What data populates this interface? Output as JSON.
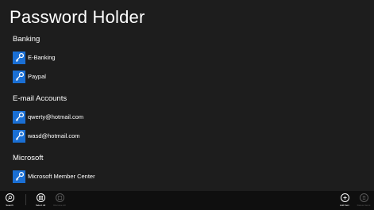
{
  "app": {
    "title": "Password Holder"
  },
  "colors": {
    "background": "#1d1d1d",
    "tile": "#1a6fd4",
    "appbar": "#0f0f0f"
  },
  "groups": [
    {
      "header": "Banking",
      "items": [
        {
          "label": "E-Banking",
          "icon": "key-icon"
        },
        {
          "label": "Paypal",
          "icon": "key-icon"
        }
      ]
    },
    {
      "header": "E-mail Accounts",
      "items": [
        {
          "label": "qwerty@hotmail.com",
          "icon": "key-icon"
        },
        {
          "label": "wasd@hotmail.com",
          "icon": "key-icon"
        }
      ]
    },
    {
      "header": "Microsoft",
      "items": [
        {
          "label": "Microsoft Member Center",
          "icon": "key-icon"
        }
      ]
    }
  ],
  "appbar": {
    "search_label": "Search",
    "select_all_label": "Select All",
    "remove_all_label": "Remove All",
    "add_item_label": "Add Item",
    "delete_label": "Delete Items"
  }
}
